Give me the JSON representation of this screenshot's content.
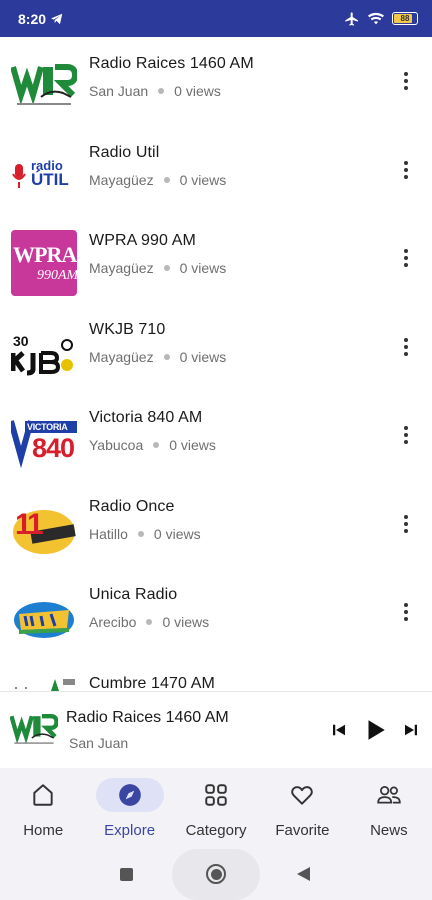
{
  "status_bar": {
    "time": "8:20",
    "battery": "88",
    "bg_color": "#2c3a9c"
  },
  "stations": [
    {
      "name": "Radio Raices 1460 AM",
      "location": "San Juan",
      "views": "0 views",
      "logo_icon": "radio-raices-logo"
    },
    {
      "name": "Radio Util",
      "location": "Mayagüez",
      "views": "0 views",
      "logo_icon": "radio-util-logo"
    },
    {
      "name": "WPRA 990 AM",
      "location": "Mayagüez",
      "views": "0 views",
      "logo_icon": "wpra-logo"
    },
    {
      "name": "WKJB 710",
      "location": "Mayagüez",
      "views": "0 views",
      "logo_icon": "wkjb-logo"
    },
    {
      "name": "Victoria 840 AM",
      "location": "Yabucoa",
      "views": "0 views",
      "logo_icon": "victoria-logo"
    },
    {
      "name": "Radio Once",
      "location": "Hatillo",
      "views": "0 views",
      "logo_icon": "radio-once-logo"
    },
    {
      "name": "Unica Radio",
      "location": "Arecibo",
      "views": "0 views",
      "logo_icon": "unica-radio-logo"
    },
    {
      "name": "Cumbre 1470 AM",
      "location": "",
      "views": "",
      "logo_icon": "cumbre-logo"
    }
  ],
  "logo_text": {
    "radio_util_top": "radio",
    "radio_util_main": "ÚTIL",
    "wpra_main": "WPRA",
    "wpra_sub": "990AM",
    "wkjb_top": "30",
    "victoria_top": "VICTORIA",
    "victoria_main": "840",
    "radio_once_main": "11"
  },
  "mini_player": {
    "title": "Radio Raices 1460 AM",
    "location": "San Juan"
  },
  "bottom_nav": [
    {
      "label": "Home",
      "icon": "home-icon",
      "active": false
    },
    {
      "label": "Explore",
      "icon": "compass-icon",
      "active": true
    },
    {
      "label": "Category",
      "icon": "category-grid-icon",
      "active": false
    },
    {
      "label": "Favorite",
      "icon": "heart-icon",
      "active": false
    },
    {
      "label": "News",
      "icon": "people-icon",
      "active": false
    }
  ],
  "colors": {
    "accent": "#3b46a3",
    "active_pill": "#dfe1f6",
    "nav_bg": "#f3f3f7"
  }
}
